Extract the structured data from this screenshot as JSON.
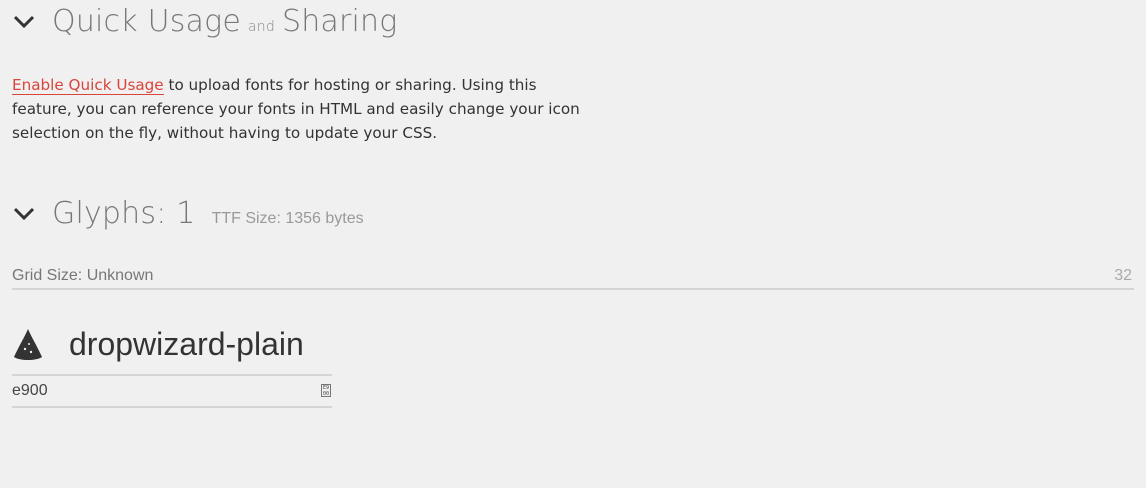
{
  "quick_usage": {
    "title_part1": "Quick Usage",
    "title_and": "and",
    "title_part2": "Sharing",
    "link_text": "Enable Quick Usage",
    "description": " to upload fonts for hosting or sharing. Using this feature, you can reference your fonts in HTML and easily change your icon selection on the fly, without having to update your CSS."
  },
  "glyphs": {
    "title": "Glyphs: 1",
    "ttf_size": "TTF Size: 1356 bytes",
    "grid_label": "Grid Size: Unknown",
    "grid_value": "32",
    "items": [
      {
        "name": "dropwizard-plain",
        "code": "e900",
        "icon": "dropwizard-hat-icon"
      }
    ]
  },
  "colors": {
    "accent": "#d9453d",
    "background": "#f0f0f0",
    "heading": "#777777"
  }
}
